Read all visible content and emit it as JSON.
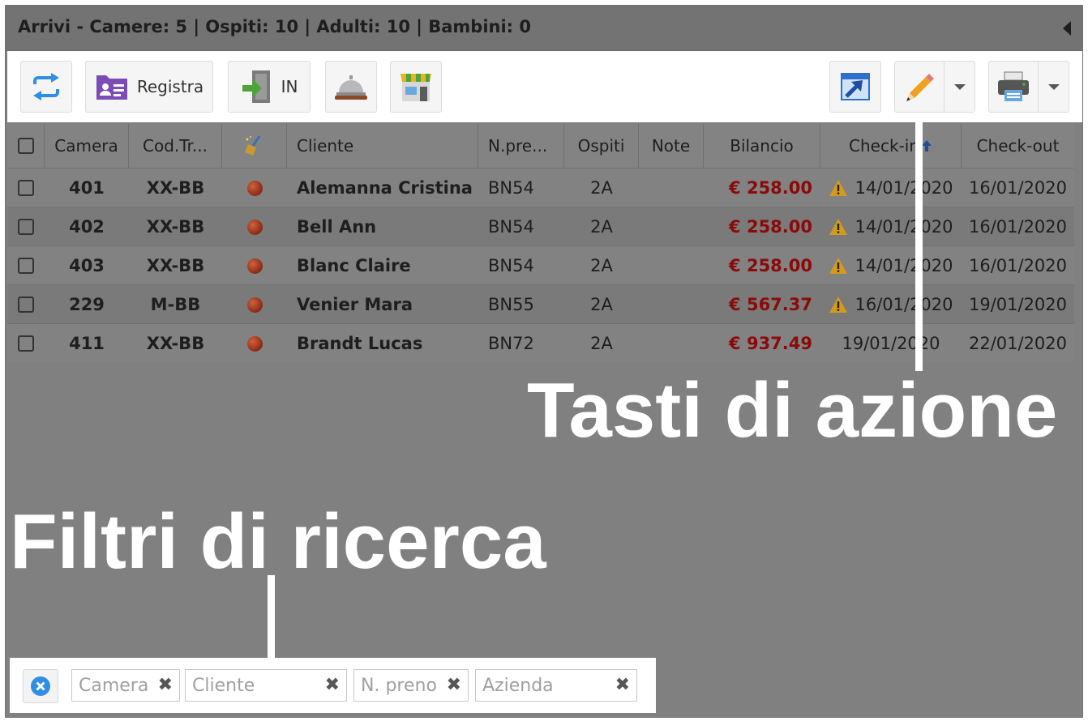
{
  "panel": {
    "title": "Arrivi - Camere: 5 | Ospiti: 10 | Adulti: 10 | Bambini: 0",
    "collapse_icon": "triangle-left-icon"
  },
  "toolbar": {
    "refresh_icon": "refresh-arrows-icon",
    "registra_label": "Registra",
    "registra_icon": "id-card-icon",
    "checkin_label": "IN",
    "checkin_icon": "door-enter-icon",
    "concierge_icon": "service-bell-icon",
    "shop_icon": "storefront-icon",
    "open_icon": "open-external-icon",
    "edit_icon": "pencil-icon",
    "print_icon": "printer-icon"
  },
  "grid": {
    "columns": [
      "Camera",
      "Cod.Tr...",
      "Cliente",
      "N.pre...",
      "Ospiti",
      "Note",
      "Bilancio",
      "Check-in",
      "Check-out"
    ],
    "housekeeping_icon": "broom-icon",
    "sort_icon": "arrow-up-icon",
    "rows": [
      {
        "camera": "401",
        "cod": "XX-BB",
        "cliente": "Alemanna Cristina",
        "npreno": "BN54",
        "ospiti": "2A",
        "note": "",
        "bilancio": "€ 258.00",
        "checkin": "14/01/2020",
        "warning": true,
        "checkout": "16/01/2020"
      },
      {
        "camera": "402",
        "cod": "XX-BB",
        "cliente": "Bell Ann",
        "npreno": "BN54",
        "ospiti": "2A",
        "note": "",
        "bilancio": "€ 258.00",
        "checkin": "14/01/2020",
        "warning": true,
        "checkout": "16/01/2020"
      },
      {
        "camera": "403",
        "cod": "XX-BB",
        "cliente": "Blanc Claire",
        "npreno": "BN54",
        "ospiti": "2A",
        "note": "",
        "bilancio": "€ 258.00",
        "checkin": "14/01/2020",
        "warning": true,
        "checkout": "16/01/2020"
      },
      {
        "camera": "229",
        "cod": "M-BB",
        "cliente": "Venier Mara",
        "npreno": "BN55",
        "ospiti": "2A",
        "note": "",
        "bilancio": "€ 567.37",
        "checkin": "16/01/2020",
        "warning": true,
        "checkout": "19/01/2020"
      },
      {
        "camera": "411",
        "cod": "XX-BB",
        "cliente": "Brandt Lucas",
        "npreno": "BN72",
        "ospiti": "2A",
        "note": "",
        "bilancio": "€ 937.49",
        "checkin": "19/01/2020",
        "warning": false,
        "checkout": "22/01/2020"
      }
    ]
  },
  "annotations": {
    "actions": "Tasti di azione",
    "filters": "Filtri di ricerca"
  },
  "filters": {
    "clear_icon": "clear-circle-icon",
    "camera_placeholder": "Camera",
    "cliente_placeholder": "Cliente",
    "npreno_placeholder": "N. preno",
    "azienda_placeholder": "Azienda",
    "remove_glyph": "✖"
  },
  "colors": {
    "overlay": "#808080",
    "money": "#8a0a0a",
    "accent_blue": "#2f8ee5"
  }
}
